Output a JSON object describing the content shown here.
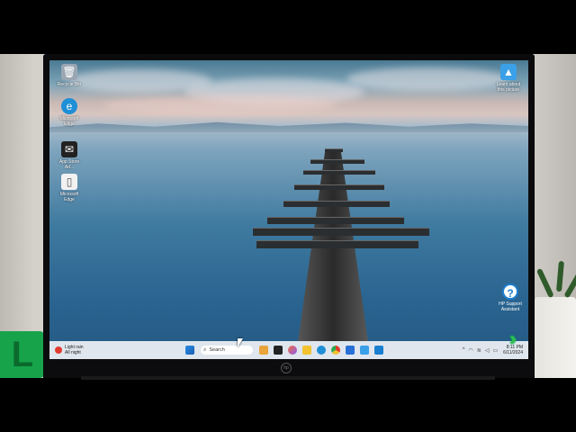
{
  "desktop": {
    "icons": [
      {
        "name": "recycle-bin-icon",
        "label": "Recycle Bin",
        "color": "#9aa6b2",
        "glyph": "🗑"
      },
      {
        "name": "edge-icon",
        "label": "Microsoft\nEdge",
        "color": "#1f8fd6",
        "glyph": "e"
      },
      {
        "name": "app-shortcut-icon",
        "label": "App Store\nAd...",
        "color": "#222222",
        "glyph": "✉"
      },
      {
        "name": "file-icon",
        "label": "Microsoft\nEdge",
        "color": "#f2f2f2",
        "glyph": "▯"
      }
    ],
    "learn_label": "Learn about\nthis picture",
    "hp_support_label": "HP Support\nAssistant"
  },
  "taskbar": {
    "weather_line1": "Light rain",
    "weather_line2": "All night",
    "search_placeholder": "Search",
    "clock_time": "8:11 PM",
    "clock_date": "6/11/2024",
    "colors": {
      "accent": "#1e7fd0"
    }
  }
}
